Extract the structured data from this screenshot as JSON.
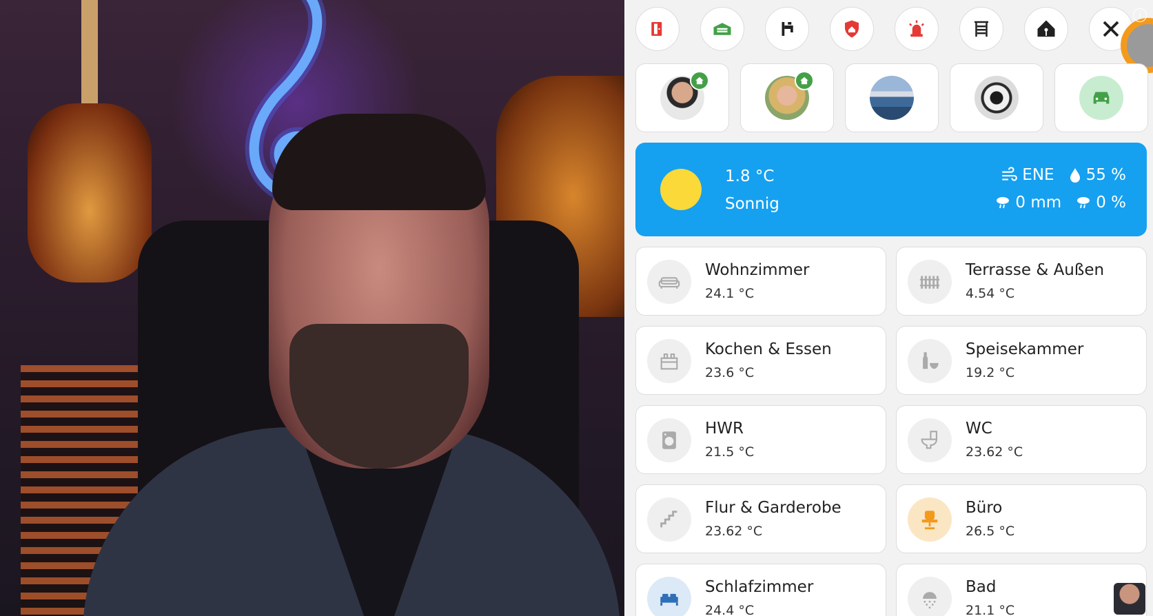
{
  "shortcuts": [
    {
      "icon": "door-icon",
      "color": "#e53935"
    },
    {
      "icon": "garage-icon",
      "color": "#43a047"
    },
    {
      "icon": "tap-icon",
      "color": "#212121"
    },
    {
      "icon": "shield-home-icon",
      "color": "#e53935"
    },
    {
      "icon": "alarm-light-icon",
      "color": "#e53935"
    },
    {
      "icon": "window-shutter-icon",
      "color": "#212121"
    },
    {
      "icon": "home-assistant-icon",
      "color": "#212121"
    },
    {
      "icon": "tools-icon",
      "color": "#212121"
    }
  ],
  "persons": [
    {
      "name": "person-1",
      "home": true
    },
    {
      "name": "person-2",
      "home": true
    },
    {
      "name": "landscape"
    },
    {
      "name": "soccer-ball"
    },
    {
      "name": "car"
    }
  ],
  "weather": {
    "temperature": "1.8 °C",
    "condition": "Sonnig",
    "wind": "ENE",
    "humidity": "55 %",
    "precipitation": "0 mm",
    "precip_probability": "0 %"
  },
  "rooms": [
    {
      "name": "Wohnzimmer",
      "temp": "24.1 °C",
      "icon": "sofa-icon"
    },
    {
      "name": "Terrasse & Außen",
      "temp": "4.54 °C",
      "icon": "fence-icon"
    },
    {
      "name": "Kochen & Essen",
      "temp": "23.6 °C",
      "icon": "stove-icon"
    },
    {
      "name": "Speisekammer",
      "temp": "19.2 °C",
      "icon": "bottle-bowl-icon"
    },
    {
      "name": "HWR",
      "temp": "21.5 °C",
      "icon": "washing-machine-icon"
    },
    {
      "name": "WC",
      "temp": "23.62 °C",
      "icon": "toilet-icon"
    },
    {
      "name": "Flur & Garderobe",
      "temp": "23.62 °C",
      "icon": "stairs-icon"
    },
    {
      "name": "Büro",
      "temp": "26.5 °C",
      "icon": "office-chair-icon"
    },
    {
      "name": "Schlafzimmer",
      "temp": "24.4 °C",
      "icon": "bed-icon"
    },
    {
      "name": "Bad",
      "temp": "21.1 °C",
      "icon": "shower-icon"
    }
  ],
  "colors": {
    "accent_orange": "#f39a1d",
    "weather_bg": "#16a0f0",
    "sun": "#fbd938"
  }
}
